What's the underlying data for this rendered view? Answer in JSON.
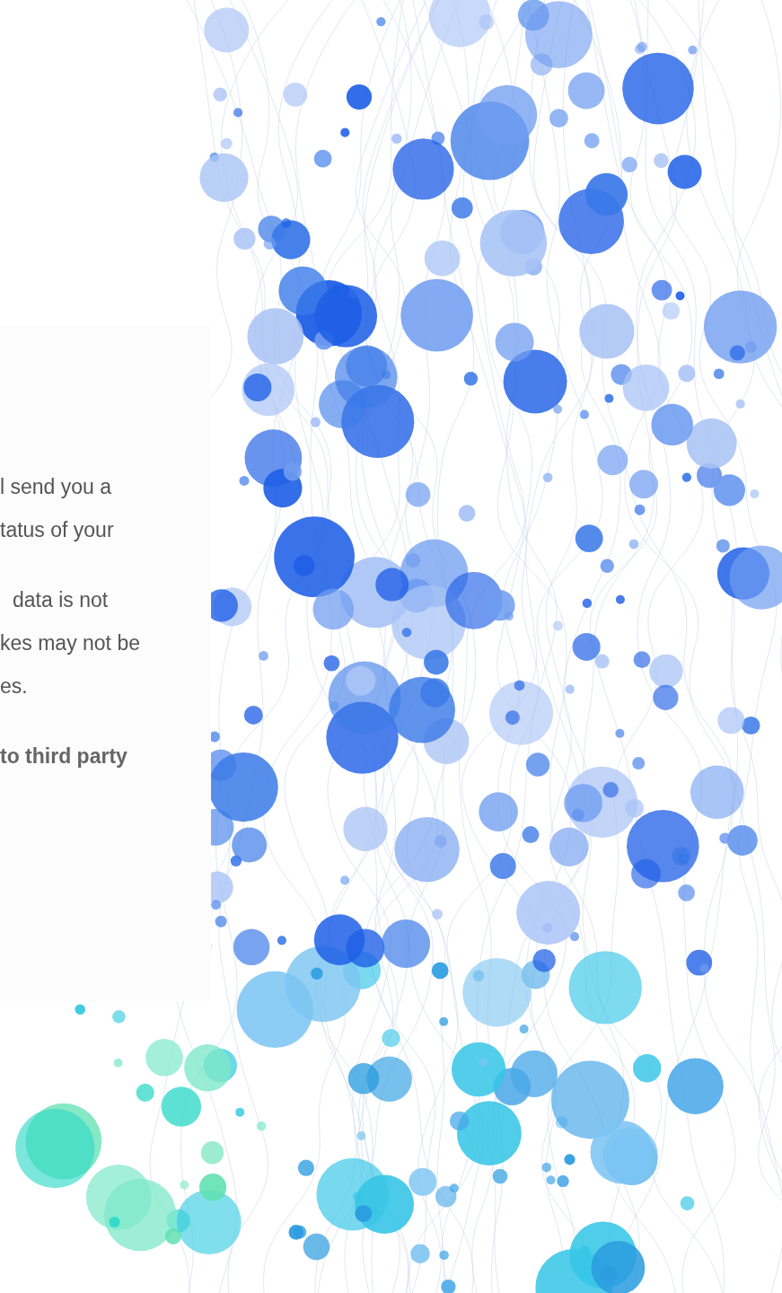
{
  "card": {
    "paragraphs": [
      {
        "bold": false,
        "lines": [
          "l send you a",
          "tatus of your"
        ]
      },
      {
        "bold": false,
        "lines": [
          "data is not",
          "kes may not be",
          "es."
        ]
      },
      {
        "bold": true,
        "lines": [
          "to third party"
        ]
      }
    ]
  }
}
